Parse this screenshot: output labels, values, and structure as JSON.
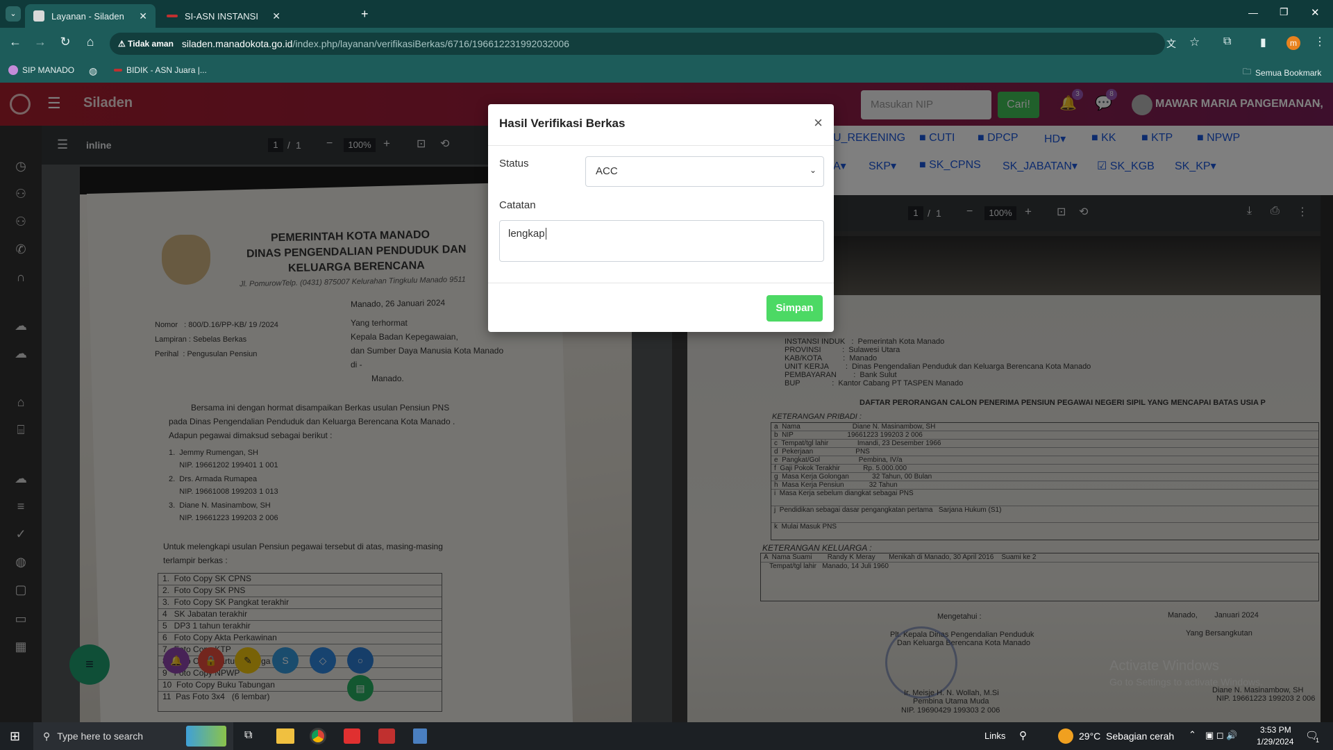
{
  "browser": {
    "tabs": [
      {
        "label": "Layanan - Siladen",
        "active": true
      },
      {
        "label": "SI-ASN INSTANSI",
        "active": false
      }
    ],
    "address": {
      "security_label": "Tidak aman",
      "host": "siladen.manadokota.go.id",
      "path": "/index.php/layanan/verifikasiBerkas/6716/196612231992032006"
    },
    "bookmarks": [
      "SIP MANADO",
      "BIDIK - ASN Juara |..."
    ],
    "all_bookmarks": "Semua Bookmark"
  },
  "app": {
    "name": "Siladen",
    "search_placeholder": "Masukan NIP",
    "search_button": "Cari!",
    "notif_count": "3",
    "msg_count": "8",
    "user_name": "MAWAR MARIA PANGEMANAN,",
    "doc_tabs_row1": [
      "U_REKENING",
      "CUTI",
      "DPCP",
      "HD",
      "KK",
      "KTP",
      "NPWP"
    ],
    "doc_tabs_row2": [
      "A",
      "SKP",
      "SK_CPNS",
      "SK_JABATAN",
      "SK_KGB",
      "SK_KP"
    ]
  },
  "viewer_left": {
    "title": "inline",
    "page": "1",
    "pages": "1",
    "zoom": "100%"
  },
  "viewer_right": {
    "page": "1",
    "pages": "1",
    "zoom": "100%"
  },
  "doc_left": {
    "heading1": "PEMERINTAH KOTA MANADO",
    "heading2": "DINAS PENGENDALIAN PENDUDUK DAN",
    "heading3": "KELUARGA BERENCANA",
    "address": "Jl. PomurowTelp. (0431) 875007 Kelurahan Tingkulu Manado 9511",
    "date": "Manado, 26 Januari 2024",
    "nomor": "Nomor   : 800/D.16/PP-KB/ 19 /2024",
    "lampiran": "Lampiran : Sebelas Berkas",
    "perihal": "Perihal  : Pengusulan Pensiun",
    "to1": "Yang terhormat",
    "to2": "Kepala Badan Kepegawaian,",
    "to3": "dan Sumber Daya Manusia Kota Manado",
    "to4": "di -",
    "to5": "Manado.",
    "body1": "Bersama ini dengan hormat disampaikan Berkas usulan Pensiun PNS",
    "body2": "pada Dinas Pengendalian Penduduk dan Keluarga Berencana Kota Manado .",
    "body3": "Adapun pegawai dimaksud sebagai berikut :",
    "people": [
      "1.  Jemmy Rumengan, SH",
      "     NIP. 19661202 199401 1 001",
      "2.  Drs. Armada Rumapea",
      "     NIP. 19661008 199203 1 013",
      "3.  Diane N. Masinambow, SH",
      "     NIP. 19661223 199203 2 006"
    ],
    "body4": "Untuk melengkapi usulan Pensiun pegawai tersebut di atas, masing-masing",
    "body5": "terlampir berkas :",
    "attachments": [
      "1.  Foto Copy SK CPNS",
      "2.  Foto Copy SK PNS",
      "3.  Foto Copy SK Pangkat terakhir",
      "4   SK Jabatan terakhir",
      "5   DP3 1 tahun terakhir",
      "6   Foto Copy Akta Perkawinan",
      "7   Foto Copy KTP",
      "8   Foto Copy Kartu Keluarga",
      "9   Foto Copy NPWP",
      "10  Foto Copy Buku Tabungan",
      "11  Pas Foto 3x4   (6 lembar)"
    ]
  },
  "doc_right": {
    "instansi": "INSTANSI INDUK   :  Pemerintah Kota Manado",
    "provinsi": "PROVINSI          :  Sulawesi Utara",
    "kab": "KAB/KOTA          :  Manado",
    "unit": "UNIT KERJA        :  Dinas Pengendalian Penduduk dan Keluarga Berencana Kota Manado",
    "pembayaran": "PEMBAYARAN        :  Bank Sulut",
    "bup": "BUP               :  Kantor Cabang PT TASPEN Manado",
    "title": "DAFTAR PERORANGAN CALON PENERIMA PENSIUN PEGAWAI NEGERI SIPIL YANG MENCAPAI BATAS USIA P",
    "section1": "KETERANGAN PRIBADI :",
    "rows": [
      "a  Nama                           Diane N. Masinambow, SH",
      "b  NIP                            19661223 199203 2 006",
      "c  Tempat/tgl lahir               Imandi, 23 Desember 1966",
      "d  Pekerjaan                      PNS",
      "e  Pangkat/Gol                    Pembina, IV/a",
      "f  Gaji Pokok Terakhir            Rp. 5.000.000",
      "g  Masa Kerja Golongan            32 Tahun, 00 Bulan",
      "h  Masa Kerja Pensiun             32 Tahun",
      "i  Masa Kerja sebelum diangkat sebagai PNS",
      "j  Pendidikan sebagai dasar pengangkatan pertama   Sarjana Hukum (S1)",
      "k  Mulai Masuk PNS"
    ],
    "section2": "KETERANGAN KELUARGA :",
    "suami": "A  Nama Suami        Randy K Meray       Menikah di Manado, 30 April 2016    Suami ke 2",
    "suami_lahir": "   Tempat/tgl lahir   Manado, 14 Juli 1960",
    "mengetahui": "Mengetahui :",
    "kepala": "Plt. Kepala Dinas Pengendalian Penduduk",
    "kepala2": "Dan Keluarga Berencana Kota Manado",
    "signer": "Ir. Meisje H. N. Wollah, M.Si",
    "signer_rank": "Pembina Utama Muda",
    "signer_nip": "NIP. 19690429 199303 2 006",
    "place_date": "Manado,        Januari 2024",
    "ybs": "Yang Bersangkutan",
    "ybs_name": "Diane N. Masinambow, SH",
    "ybs_nip": "NIP. 19661223 199203 2 006",
    "watermark1": "Activate Windows",
    "watermark2": "Go to Settings to activate Windows."
  },
  "modal": {
    "title": "Hasil Verifikasi Berkas",
    "status_label": "Status",
    "status_value": "ACC",
    "note_label": "Catatan",
    "note_value": "lengkap",
    "save_button": "Simpan"
  },
  "taskbar": {
    "search_placeholder": "Type here to search",
    "links": "Links",
    "weather": "29°C  Sebagian cerah",
    "time": "3:53 PM",
    "date": "1/29/2024",
    "notif": "1"
  },
  "colors": {
    "chrome": "#1d5c5a",
    "header_start": "#a81e2d",
    "header_end": "#7a1f58",
    "accent_green": "#4cd964",
    "link_blue": "#1a56db"
  }
}
